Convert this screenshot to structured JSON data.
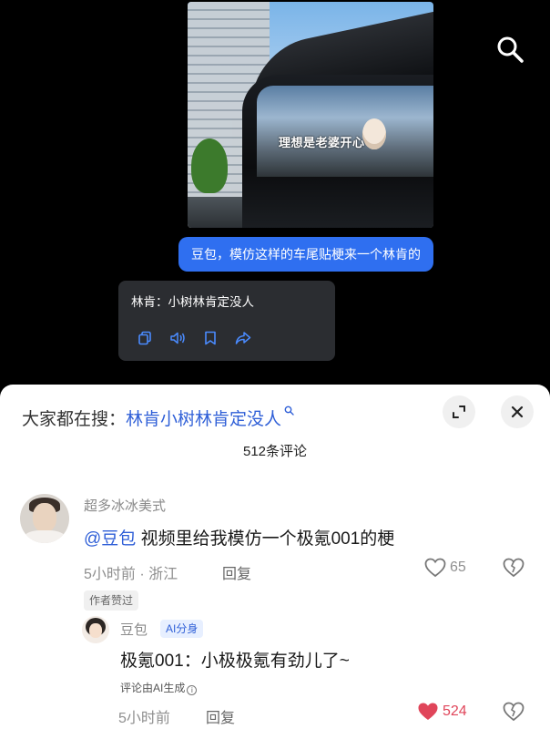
{
  "chat": {
    "photo_sticker_text": "理想是老婆开心",
    "user_message": "豆包，模仿这样的车尾贴梗来一个林肯的",
    "ai_reply": "林肯：小树林肯定没人",
    "ai_actions": [
      "copy-icon",
      "speaker-icon",
      "bookmark-icon",
      "share-icon"
    ]
  },
  "sheet": {
    "hot_search_prefix": "大家都在搜：",
    "hot_search_term": "林肯小树林肯定没人",
    "comment_count": "512条评论"
  },
  "comments": [
    {
      "user": "超多冰冰美式",
      "mention": "@豆包",
      "text": " 视频里给我模仿一个极氪001的梗",
      "meta": "5小时前 · 浙江",
      "reply_label": "回复",
      "likes": "65",
      "author_tag": "作者赞过"
    },
    {
      "user": "豆包",
      "badge": "AI分身",
      "text": "极氪001：小极极氪有劲儿了~",
      "ai_note": "评论由AI生成",
      "meta": "5小时前",
      "reply_label": "回复",
      "likes": "524"
    }
  ],
  "colors": {
    "accent_blue": "#2f6ff0",
    "link_blue": "#2f5fd7",
    "like_red": "#e0455a",
    "sheet_bg": "#ffffff",
    "chat_bg": "#000000"
  }
}
